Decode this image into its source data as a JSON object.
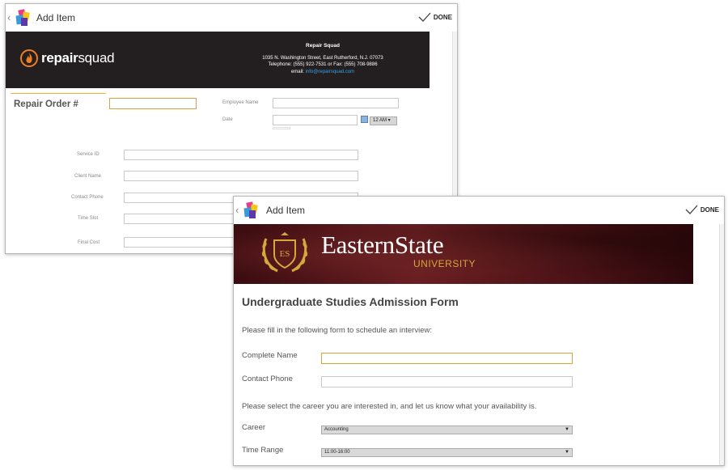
{
  "colors": {
    "accent": "#f0b030",
    "repair_header": "#231f20",
    "banner": "#5a1a1c",
    "email_link": "#39a0e8",
    "university_gold": "#d4a83a"
  },
  "window1": {
    "title": "Add Item",
    "done_label": "DONE",
    "company": {
      "name": "Repair Squad",
      "logo_text_bold": "repair",
      "logo_text_regular": "squad",
      "address": "1035 N. Washington Street, East Rutherford, N.J. 07073",
      "phone_line": "Telephone: (555) 922-7531 or Fax: (555) 708-9886",
      "email_label": "email: ",
      "email_value": "info@repairsquad.com"
    },
    "form": {
      "repair_order_label": "Repair Order #",
      "employee_name_label": "Employee Name",
      "date_label": "Date",
      "time_value": "12 AM",
      "service_id_label": "Service ID",
      "client_name_label": "Client Name",
      "contact_phone_label": "Contact Phone",
      "time_slot_label": "Time Slot",
      "final_cost_label": "Final Cost"
    }
  },
  "window2": {
    "title": "Add Item",
    "done_label": "DONE",
    "banner": {
      "crest_initials": "ES",
      "name": "EasternState",
      "subtitle": "UNIVERSITY"
    },
    "form": {
      "title": "Undergraduate Studies Admission Form",
      "intro": "Please fill in the following form to schedule an interview:",
      "complete_name_label": "Complete Name",
      "contact_phone_label": "Contact Phone",
      "career_prompt": "Please select the career you are interested in, and let us know what your availability is.",
      "career_label": "Career",
      "career_value": "Accounting",
      "time_range_label": "Time Range",
      "time_range_value": "11:00-16:00"
    }
  }
}
